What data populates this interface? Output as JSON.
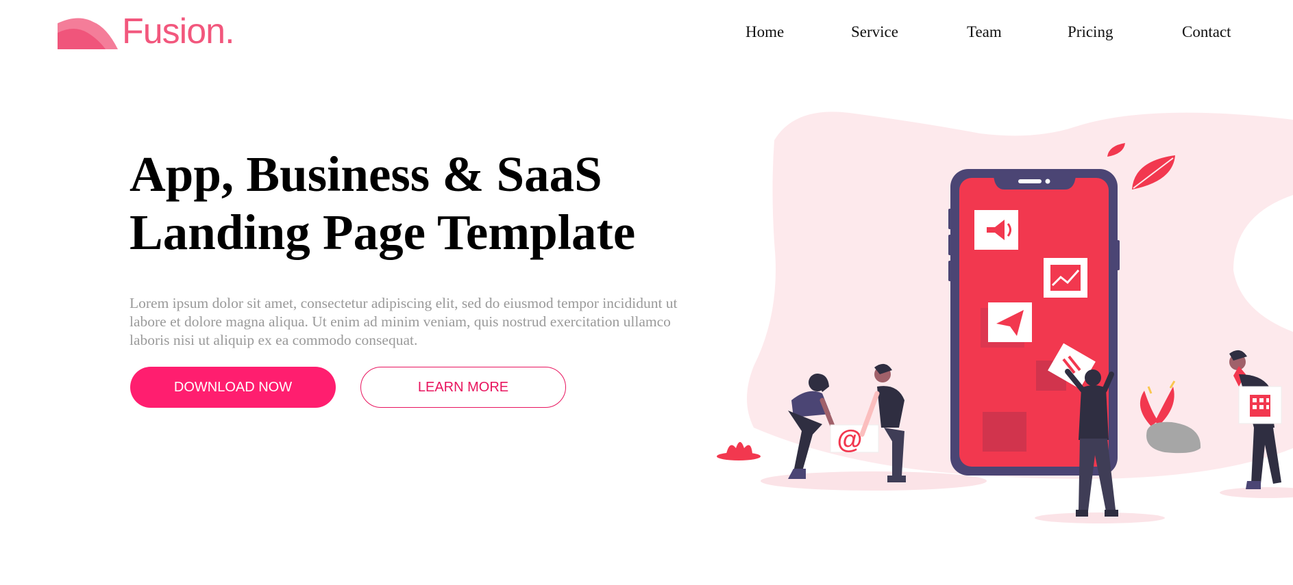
{
  "brand": {
    "name": "Fusion.",
    "color": "#f2577d"
  },
  "nav": {
    "items": [
      {
        "label": "Home"
      },
      {
        "label": "Service"
      },
      {
        "label": "Team"
      },
      {
        "label": "Pricing"
      },
      {
        "label": "Contact"
      }
    ]
  },
  "hero": {
    "title_line1": "App, Business & SaaS",
    "title_line2": "Landing Page Template",
    "description": "Lorem ipsum dolor sit amet, consectetur adipiscing elit, sed do eiusmod tempor incididunt ut labore et dolore magna aliqua. Ut enim ad minim veniam, quis nostrud exercitation ullamco laboris nisi ut aliquip ex ea commodo consequat.",
    "primary_button": "DOWNLOAD NOW",
    "secondary_button": "LEARN MORE"
  },
  "illustration": {
    "icons": [
      "megaphone-icon",
      "chart-icon",
      "paper-plane-icon",
      "at-sign-icon",
      "building-icon"
    ],
    "at_symbol": "@",
    "colors": {
      "accent": "#f2384f",
      "phone_frame": "#4b4574",
      "blob": "#fde9ec",
      "primary_button": "#ff1e6f"
    }
  }
}
